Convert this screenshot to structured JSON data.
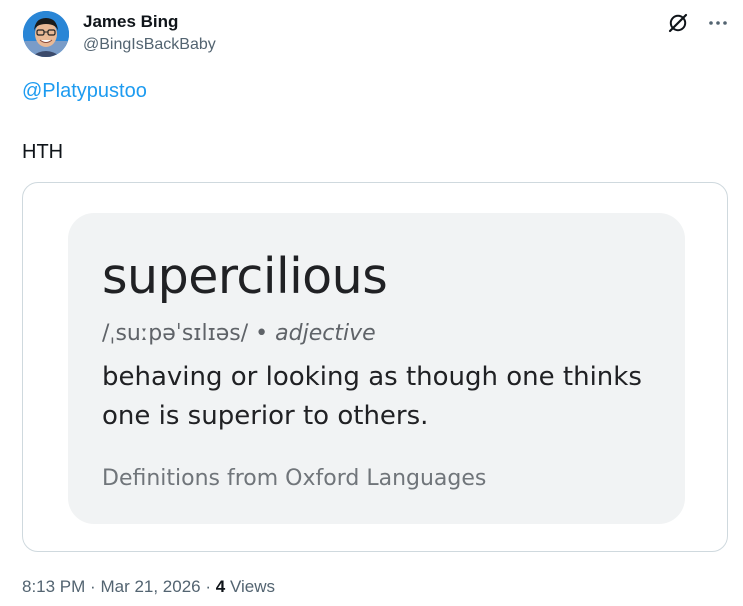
{
  "author": {
    "name": "James Bing",
    "handle": "@BingIsBackBaby"
  },
  "post": {
    "mention": "@Platypustoo",
    "text": "HTH"
  },
  "definition_card": {
    "word": "supercilious",
    "pronunciation": "/ˌsuːpəˈsɪlɪəs/",
    "separator": "•",
    "part_of_speech": "adjective",
    "meaning": "behaving or looking as though one thinks one is superior to others.",
    "source": "Definitions from Oxford Languages"
  },
  "meta": {
    "time": "8:13 PM",
    "dot1": "·",
    "date": "Mar 21, 2026",
    "dot2": "·",
    "view_count": "4",
    "views_label": "Views"
  },
  "icons": {
    "grok": "grok-icon",
    "more": "more-icon"
  },
  "colors": {
    "link": "#1d9bf0",
    "secondary_text": "#536471",
    "card_border": "#cfd9de",
    "definition_bg": "#f1f3f4"
  }
}
